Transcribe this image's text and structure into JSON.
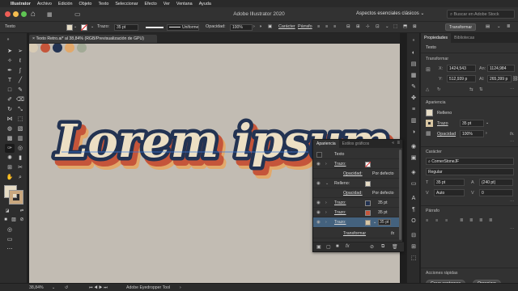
{
  "menubar": {
    "apple_glyph": "",
    "items": [
      "Illustrator",
      "Archivo",
      "Edición",
      "Objeto",
      "Texto",
      "Seleccionar",
      "Efecto",
      "Ver",
      "Ventana",
      "Ayuda"
    ]
  },
  "appbar": {
    "title": "Adobe Illustrator 2020",
    "workspace": "Aspectos esenciales clásicos",
    "workspace_icon": "chevron-down-icon",
    "search_placeholder": "Buscar en Adobe Stock"
  },
  "controlbar": {
    "object_label": "Texto",
    "stroke_label": "Trazo:",
    "stroke_value": "35 pt",
    "brush_label": "Uniforme",
    "opacity_label": "Opacidad:",
    "opacity_value": "100%",
    "character_label": "Carácter",
    "paragraph_label": "Párrafo",
    "transform_label": "Transformar"
  },
  "document": {
    "tab_title": "Texto Retro.ai* al 38,84% (RGB/Previsualización de GPU)",
    "artwork_text": "Lorem ipsum",
    "swatch_colors": [
      "#d8cbb4",
      "#c5553a",
      "#233352",
      "#e2a86a",
      "#a2aa96"
    ]
  },
  "appearance_panel": {
    "tabs": [
      "Apariencia",
      "Estilos gráficos"
    ],
    "object": "Texto",
    "rows": [
      {
        "kind": "stroke",
        "label": "Trazo:",
        "swatch": "#ffffff",
        "value": "",
        "nostroke": true
      },
      {
        "kind": "opacity",
        "label": "Opacidad:",
        "value": "Por defecto"
      },
      {
        "kind": "fill",
        "label": "Relleno:",
        "swatch": "#e6dcc5",
        "value": ""
      },
      {
        "kind": "opacity",
        "label": "Opacidad:",
        "value": "Por defecto"
      },
      {
        "kind": "stroke",
        "label": "Trazo:",
        "swatch": "#233352",
        "value": "35 pt"
      },
      {
        "kind": "stroke",
        "label": "Trazo:",
        "swatch": "#c5553a",
        "value": "35 pt"
      },
      {
        "kind": "stroke",
        "label": "Trazo:",
        "swatch": "#d8c6a3",
        "value": "35 pt",
        "selected": true
      }
    ],
    "effect": "Transformar",
    "fx_label": "fx"
  },
  "properties_panel": {
    "tabs": [
      "Propiedades",
      "Bibliotecas"
    ],
    "object": "Texto",
    "transform_title": "Transformar",
    "x_label": "X:",
    "x_value": "1424,543",
    "y_label": "Y:",
    "y_value": "512,939 p",
    "w_label": "An:",
    "w_value": "1124,984",
    "h_label": "Al:",
    "h_value": "265,399 p",
    "appearance_title": "Apariencia",
    "fill_label": "Relleno",
    "stroke_label": "Trazo",
    "stroke_value": "35 pt",
    "opacity_label": "Opacidad",
    "opacity_value": "100%",
    "character_title": "Carácter",
    "font_family": "CornerStoneJF",
    "font_style": "Regular",
    "font_size": "35 pt",
    "leading": "(240 pt)",
    "kerning": "Auto",
    "tracking": "0",
    "paragraph_title": "Párrafo",
    "quick_actions_title": "Acciones rápidas",
    "create_outlines": "Crear contornos",
    "arrange": "Organizar"
  },
  "statusbar": {
    "zoom": "38,84%",
    "tool": "Adobe Eyedropper Tool"
  },
  "colors": {
    "canvas": "#c2bcb3",
    "selection": "#44627e",
    "lettering_cream": "#ecdfc4",
    "lettering_navy": "#233352",
    "lettering_red": "#c5553a",
    "lettering_orange": "#e2a86a"
  }
}
